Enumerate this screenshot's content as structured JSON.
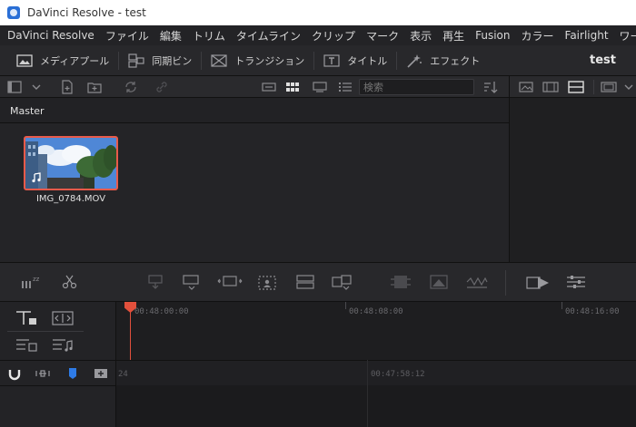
{
  "window": {
    "title": "DaVinci Resolve - test"
  },
  "menu": [
    "DaVinci Resolve",
    "ファイル",
    "編集",
    "トリム",
    "タイムライン",
    "クリップ",
    "マーク",
    "表示",
    "再生",
    "Fusion",
    "カラー",
    "Fairlight",
    "ワークスペース"
  ],
  "toolbar": {
    "media_pool": "メディアプール",
    "sync_bin": "同期ビン",
    "transitions": "トランジション",
    "titles": "タイトル",
    "effects": "エフェクト",
    "project_name": "test"
  },
  "search": {
    "placeholder": "検索"
  },
  "bin": {
    "name": "Master"
  },
  "clips": [
    {
      "name": "IMG_0784.MOV"
    }
  ],
  "ruler": {
    "timecodes": [
      "00:48:00:00",
      "00:48:08:00",
      "00:48:16:00"
    ]
  },
  "timeline2": {
    "timecodes": [
      "24",
      "00:47:58:12"
    ]
  },
  "colors": {
    "accent": "#e85a4a",
    "playhead": "#e2503c",
    "flag_blue": "#2e7be6"
  }
}
